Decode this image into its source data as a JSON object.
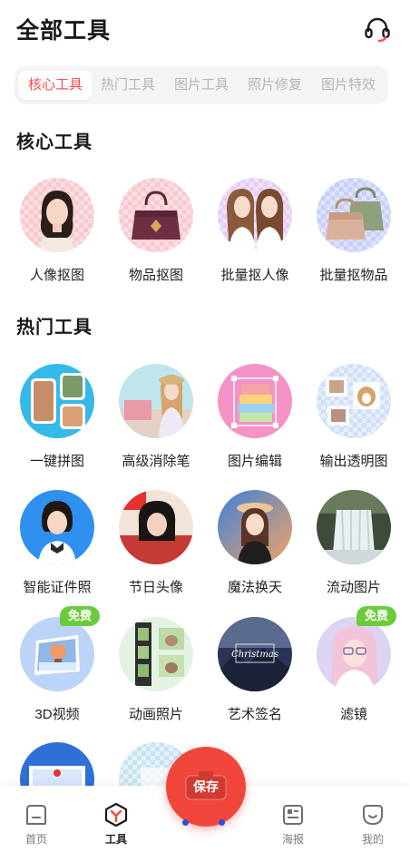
{
  "header": {
    "title": "全部工具",
    "support_icon": "headset-icon"
  },
  "tabs": [
    {
      "label": "核心工具",
      "active": true
    },
    {
      "label": "热门工具",
      "active": false
    },
    {
      "label": "图片工具",
      "active": false
    },
    {
      "label": "照片修复",
      "active": false
    },
    {
      "label": "图片特效",
      "active": false
    }
  ],
  "sections": {
    "core": {
      "title": "核心工具",
      "items": [
        {
          "label": "人像抠图"
        },
        {
          "label": "物品抠图"
        },
        {
          "label": "批量抠人像"
        },
        {
          "label": "批量抠物品"
        }
      ]
    },
    "hot": {
      "title": "热门工具",
      "items": [
        {
          "label": "一键拼图"
        },
        {
          "label": "高级消除笔"
        },
        {
          "label": "图片编辑"
        },
        {
          "label": "输出透明图"
        },
        {
          "label": "智能证件照"
        },
        {
          "label": "节日头像"
        },
        {
          "label": "魔法换天"
        },
        {
          "label": "流动图片"
        },
        {
          "label": "3D视频",
          "badge": "免费"
        },
        {
          "label": "动画照片"
        },
        {
          "label": "艺术签名"
        },
        {
          "label": "滤镜",
          "badge": "免费"
        }
      ]
    }
  },
  "signature_text": "Christmas",
  "fab": {
    "label": "保存",
    "accent": "#f0463c"
  },
  "bottom_nav": [
    {
      "label": "首页",
      "icon": "home-icon"
    },
    {
      "label": "工具",
      "icon": "tools-icon",
      "active": true
    },
    {
      "label": "海报",
      "icon": "poster-icon"
    },
    {
      "label": "我的",
      "icon": "profile-icon"
    }
  ],
  "colors": {
    "accent_red": "#ff4a4a",
    "badge_green": "#6ccb3c",
    "dot_blue": "#2e4fd6"
  }
}
